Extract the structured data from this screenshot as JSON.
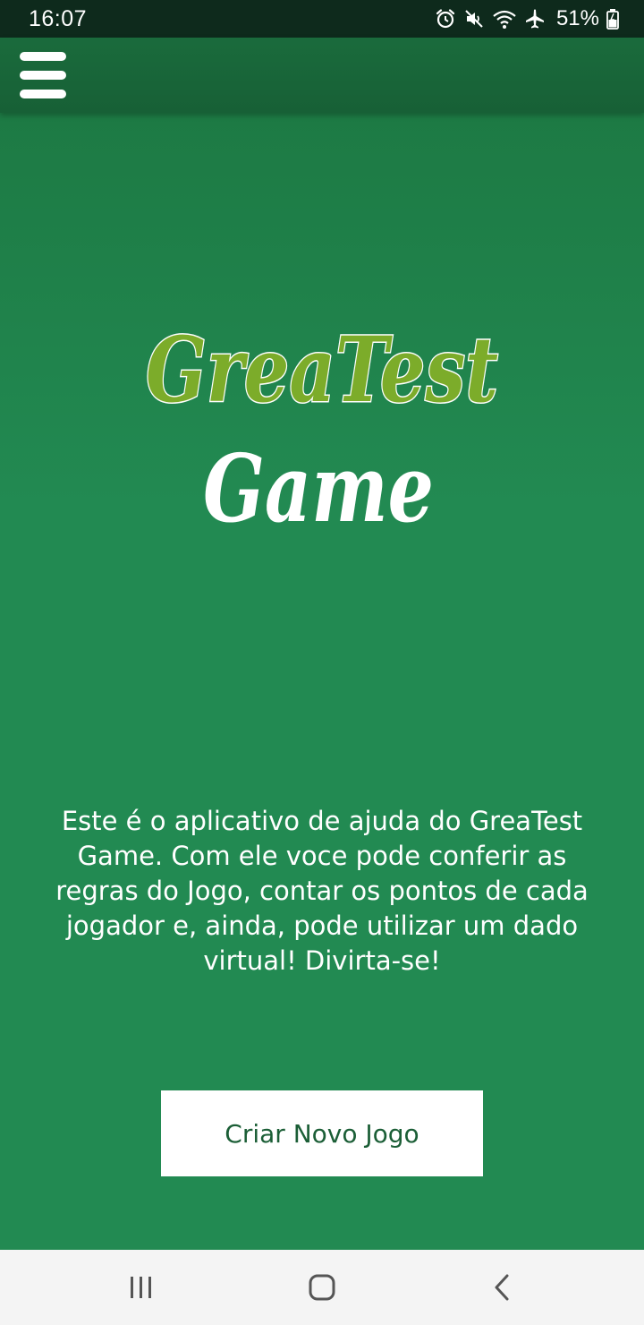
{
  "status_bar": {
    "time": "16:07",
    "battery": "51%",
    "icons": [
      "alarm-icon",
      "mute-icon",
      "wifi-icon",
      "airplane-icon",
      "battery-icon"
    ]
  },
  "app_bar": {
    "menu_icon": "hamburger-menu-icon"
  },
  "logo": {
    "line1": "GreaTest",
    "line2": "Game",
    "line1_color": "#7cac2a",
    "line2_color": "#ffffff"
  },
  "main": {
    "description": "Este é o aplicativo de ajuda do GreaTest Game. Com ele voce pode conferir as regras do Jogo, contar os pontos de cada jogador e, ainda, pode utilizar um dado virtual! Divirta-se!",
    "create_button_label": "Criar Novo Jogo"
  },
  "nav_bar": {
    "items": [
      "recent-apps-icon",
      "home-icon",
      "back-icon"
    ]
  },
  "colors": {
    "background_green": "#228a52",
    "app_bar_green": "#1a6b3c",
    "status_bar": "#0e2a1c",
    "button_text": "#1b5e36"
  }
}
